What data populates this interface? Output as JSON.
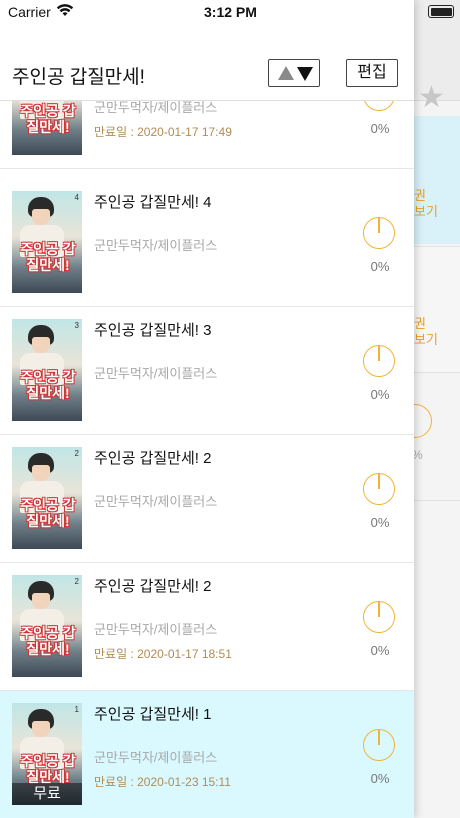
{
  "status_bar": {
    "carrier": "Carrier",
    "time": "3:12 PM"
  },
  "header": {
    "title": "주인공 갑질만세!",
    "edit_label": "편집"
  },
  "underlay": {
    "lines": [
      "권",
      "보기",
      "권",
      "보기"
    ],
    "percent": "%"
  },
  "rows": [
    {
      "title": "",
      "author": "군만두먹자/제이플러스",
      "expiry": "만료일 :  2020-01-17 17:49",
      "percent": "0%",
      "cover_title": "주인공 갑질만세!",
      "episode": "",
      "badge": ""
    },
    {
      "title": "주인공 갑질만세! 4",
      "author": "군만두먹자/제이플러스",
      "expiry": "",
      "percent": "0%",
      "cover_title": "주인공 갑질만세!",
      "episode": "4",
      "badge": ""
    },
    {
      "title": "주인공 갑질만세! 3",
      "author": "군만두먹자/제이플러스",
      "expiry": "",
      "percent": "0%",
      "cover_title": "주인공 갑질만세!",
      "episode": "3",
      "badge": ""
    },
    {
      "title": "주인공 갑질만세! 2",
      "author": "군만두먹자/제이플러스",
      "expiry": "",
      "percent": "0%",
      "cover_title": "주인공 갑질만세!",
      "episode": "2",
      "badge": ""
    },
    {
      "title": "주인공 갑질만세! 2",
      "author": "군만두먹자/제이플러스",
      "expiry": "만료일 :  2020-01-17 18:51",
      "percent": "0%",
      "cover_title": "주인공 갑질만세!",
      "episode": "2",
      "badge": ""
    },
    {
      "title": "주인공 갑질만세! 1",
      "author": "군만두먹자/제이플러스",
      "expiry": "만료일 :  2020-01-23 15:11",
      "percent": "0%",
      "cover_title": "주인공 갑질만세!",
      "episode": "1",
      "badge": "무료"
    }
  ],
  "colors": {
    "accent": "#f0b33a",
    "selected_row": "#d9f9ff",
    "expiry_text": "#b08c55"
  }
}
